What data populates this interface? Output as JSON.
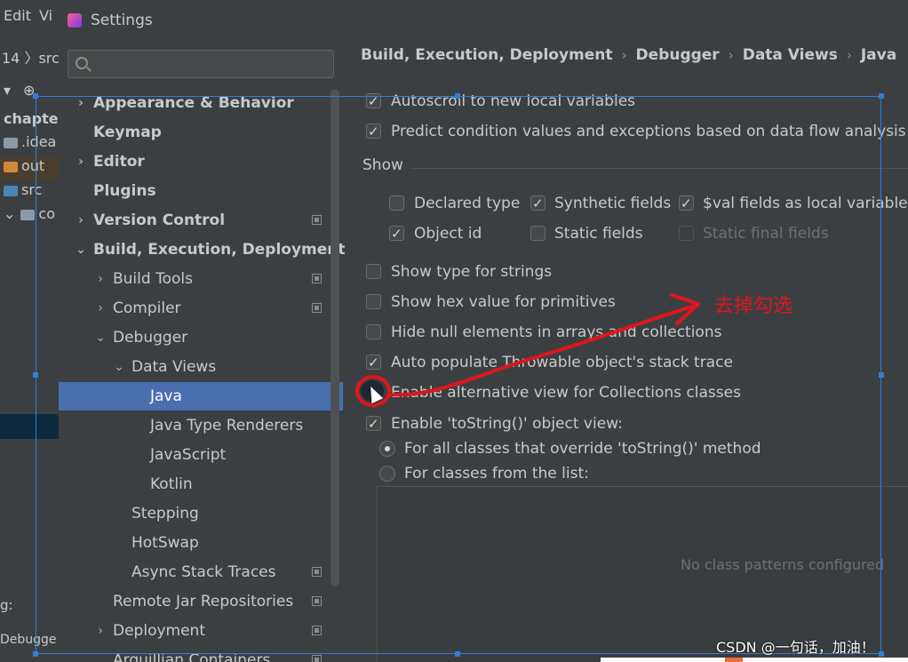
{
  "ide": {
    "menu": [
      "Edit",
      "Vi"
    ],
    "breadcrumb": "14 〉src",
    "tree": [
      {
        "label": "chapter",
        "kind": "folder"
      },
      {
        "label": ".idea",
        "kind": "folder"
      },
      {
        "label": "out",
        "kind": "folder-orange"
      },
      {
        "label": "src",
        "kind": "folder-blue"
      },
      {
        "label": "co",
        "kind": "folder"
      }
    ],
    "bottom_label": "g:",
    "bottom_tool": "Debugge"
  },
  "window": {
    "title": "Settings"
  },
  "search": {
    "placeholder": "Q▾",
    "value": ""
  },
  "breadcrumb": [
    "Build, Execution, Deployment",
    "Debugger",
    "Data Views",
    "Java"
  ],
  "nav": {
    "items": [
      {
        "label": "Appearance & Behavior",
        "level": 0,
        "chevron": "right",
        "bold": true
      },
      {
        "label": "Keymap",
        "level": 0,
        "chevron": "",
        "bold": true
      },
      {
        "label": "Editor",
        "level": 0,
        "chevron": "right",
        "bold": true
      },
      {
        "label": "Plugins",
        "level": 0,
        "chevron": "",
        "bold": true
      },
      {
        "label": "Version Control",
        "level": 0,
        "chevron": "right",
        "bold": true,
        "project_icon": true
      },
      {
        "label": "Build, Execution, Deployment",
        "level": 0,
        "chevron": "down",
        "bold": true
      },
      {
        "label": "Build Tools",
        "level": 1,
        "chevron": "right",
        "project_icon": true
      },
      {
        "label": "Compiler",
        "level": 1,
        "chevron": "right",
        "project_icon": true
      },
      {
        "label": "Debugger",
        "level": 1,
        "chevron": "down"
      },
      {
        "label": "Data Views",
        "level": 2,
        "chevron": "down"
      },
      {
        "label": "Java",
        "level": 3,
        "chevron": "",
        "selected": true
      },
      {
        "label": "Java Type Renderers",
        "level": 3,
        "chevron": ""
      },
      {
        "label": "JavaScript",
        "level": 3,
        "chevron": ""
      },
      {
        "label": "Kotlin",
        "level": 3,
        "chevron": ""
      },
      {
        "label": "Stepping",
        "level": 2,
        "chevron": ""
      },
      {
        "label": "HotSwap",
        "level": 2,
        "chevron": ""
      },
      {
        "label": "Async Stack Traces",
        "level": 2,
        "chevron": "",
        "project_icon": true
      },
      {
        "label": "Remote Jar Repositories",
        "level": 1,
        "chevron": "",
        "project_icon": true
      },
      {
        "label": "Deployment",
        "level": 1,
        "chevron": "right",
        "project_icon": true
      },
      {
        "label": "Arquillian Containers",
        "level": 1,
        "chevron": "",
        "project_icon": true
      }
    ]
  },
  "options": {
    "autoscroll": {
      "label": "Autoscroll to new local variables",
      "checked": true
    },
    "predict": {
      "label": "Predict condition values and exceptions based on data flow analysis",
      "checked": true
    },
    "show_title": "Show",
    "declared_type": {
      "label": "Declared type",
      "checked": false
    },
    "synthetic_fields": {
      "label": "Synthetic fields",
      "checked": true
    },
    "val_fields": {
      "label": "$val fields as local variables",
      "checked": true
    },
    "object_id": {
      "label": "Object id",
      "checked": true
    },
    "static_fields": {
      "label": "Static fields",
      "checked": false
    },
    "static_final_fields": {
      "label": "Static final fields",
      "checked": false,
      "disabled": true
    },
    "type_for_strings": {
      "label": "Show type for strings",
      "checked": false
    },
    "hex_primitives": {
      "label": "Show hex value for primitives",
      "checked": false
    },
    "hide_null": {
      "label": "Hide null elements in arrays and collections",
      "checked": false
    },
    "auto_populate": {
      "label": "Auto populate Throwable object's stack trace",
      "checked": true
    },
    "alt_view": {
      "label": "Enable alternative view for Collections classes",
      "checked": false
    },
    "tostring_view": {
      "label": "Enable 'toString()' object view:",
      "checked": true
    },
    "radio_all": {
      "label": "For all classes that override 'toString()' method",
      "checked": true
    },
    "radio_list": {
      "label": "For classes from the list:",
      "checked": false
    }
  },
  "patterns_empty": "No class patterns configured",
  "annotation": {
    "text": "去掉勾选",
    "color": "#e0141d"
  },
  "watermark": "CSDN @一句话，加油！",
  "colors": {
    "selected_row": "#4b6eaf",
    "accent_blue": "#2f7fd8"
  }
}
